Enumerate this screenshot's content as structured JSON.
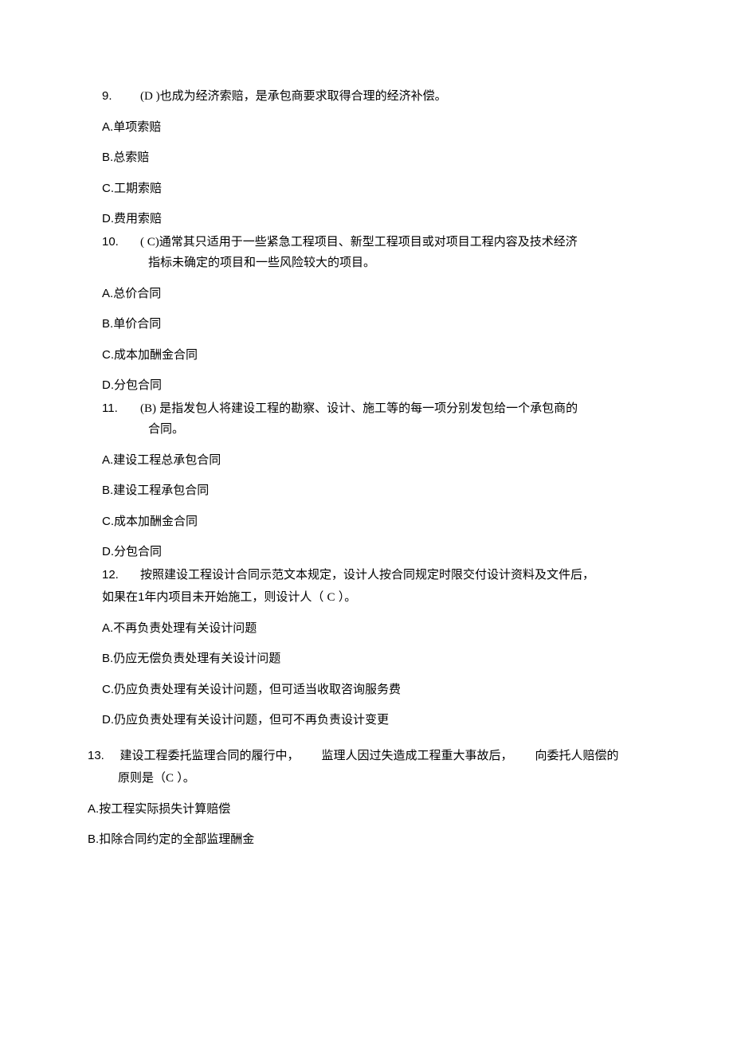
{
  "q9": {
    "num": "9.",
    "ans": "(D )",
    "text": "也成为经济索赔，是承包商要求取得合理的经济补偿。",
    "A": "A.",
    "Atext": "单项索赔",
    "B": "B.",
    "Btext": "总索赔",
    "C": "C.",
    "Ctext": "工期索赔",
    "D": "D.",
    "Dtext": "费用索赔"
  },
  "q10": {
    "num": "10.",
    "ans": "( C)",
    "text1": "通常其只适用于一些紧急工程项目、新型工程项目或对项目工程内容及技术经济",
    "text2": "指标未确定的项目和一些风险较大的项目。",
    "A": "A.",
    "Atext": "总价合同",
    "B": "B.",
    "Btext": "单价合同",
    "C": "C.",
    "Ctext": "成本加酬金合同",
    "D": "D.",
    "Dtext": "分包合同"
  },
  "q11": {
    "num": "11.",
    "ans": "(B)",
    "text1": "是指发包人将建设工程的勘察、设计、施工等的每一项分别发包给一个承包商的",
    "text2": "合同。",
    "A": "A.",
    "Atext": "建设工程总承包合同",
    "B": "B.",
    "Btext": "建设工程承包合同",
    "C": "C.",
    "Ctext": "成本加酬金合同",
    "D": "D.",
    "Dtext": "分包合同"
  },
  "q12": {
    "num": "12.",
    "text1": "按照建设工程设计合同示范文本规定，设计人按合同规定时限交付设计资料及文件后，",
    "text2a": "如果在",
    "year": "1",
    "text2b": "年内项目未开始施工，则设计人（",
    "ans": "C",
    "text2c": "）。",
    "A": "A.",
    "Atext": "不再负责处理有关设计问题",
    "B": "B.",
    "Btext": "仍应无偿负责处理有关设计问题",
    "C": "C.",
    "Ctext": "仍应负责处理有关设计问题，但可适当收取咨询服务费",
    "D": "D.",
    "Dtext": "仍应负责处理有关设计问题，但可不再负责设计变更"
  },
  "q13": {
    "num": "13.",
    "seg1": "建设工程委托监理合同的履行中，",
    "seg2": "监理人因过失造成工程重大事故后，",
    "seg3": "向委托人赔偿的",
    "text2a": "原则是（",
    "ans": "C",
    "text2b": " ）。",
    "A": "A.",
    "Atext": "按工程实际损失计算赔偿",
    "B": "B.",
    "Btext": "扣除合同约定的全部监理酬金"
  }
}
